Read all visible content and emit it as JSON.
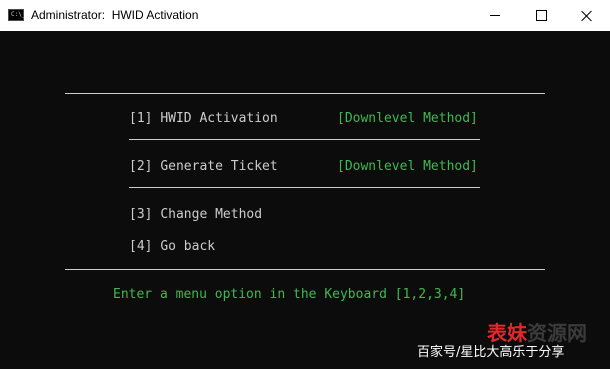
{
  "window": {
    "title": "Administrator:  HWID Activation",
    "icon": "console-icon",
    "icon_text": "C:\\_"
  },
  "console": {
    "menu_items": [
      {
        "key": "[1]",
        "label": "HWID Activation",
        "method": "[Downlevel Method]"
      },
      {
        "key": "[2]",
        "label": "Generate Ticket",
        "method": "[Downlevel Method]"
      },
      {
        "key": "[3]",
        "label": "Change Method"
      },
      {
        "key": "[4]",
        "label": "Go back"
      }
    ],
    "prompt": "Enter a menu option in the Keyboard [1,2,3,4]"
  },
  "watermark": {
    "brand_red": "表妹",
    "brand_dark": "资源网",
    "caption": "百家号/星比大高乐于分享"
  },
  "colors": {
    "console_bg": "#0c0c0c",
    "console_text": "#cccccc",
    "accent_green": "#3fb950",
    "watermark_red": "#e0292b"
  }
}
